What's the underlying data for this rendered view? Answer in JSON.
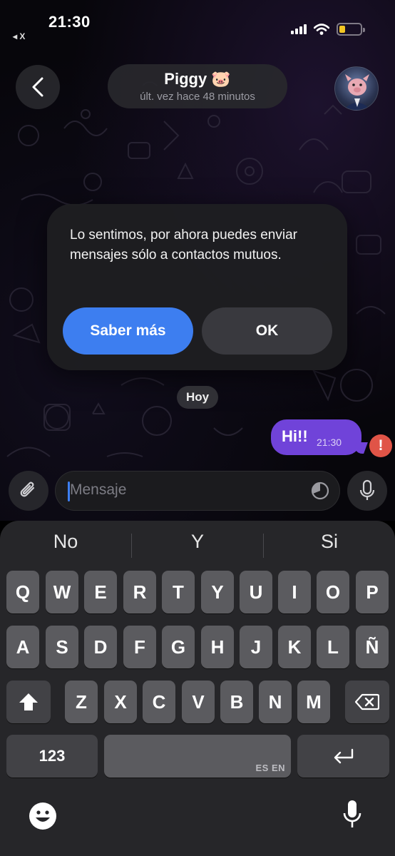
{
  "status_bar": {
    "time": "21:30",
    "back_app": "◂ X",
    "battery_color": "#f3c623"
  },
  "header": {
    "back_icon": "chevron-left-icon",
    "contact_name": "Piggy 🐷",
    "last_seen": "últ. vez hace 48 minutos",
    "avatar_icon": "avatar-pig-suit"
  },
  "alert": {
    "message": "Lo sentimos, por ahora puedes enviar mensajes sólo a contactos mutuos.",
    "learn_more_label": "Saber más",
    "ok_label": "OK",
    "accent": "#3d7ef0"
  },
  "chat": {
    "date_label": "Hoy",
    "messages": [
      {
        "text": "Hi!!",
        "time": "21:30",
        "outgoing": true,
        "failed": true,
        "error_badge": "!"
      }
    ],
    "bubble_color": "#7043d9"
  },
  "composer": {
    "attach_icon": "paperclip-icon",
    "placeholder": "Mensaje",
    "timer_icon": "timer-icon",
    "mic_icon": "microphone-icon"
  },
  "keyboard": {
    "suggestions": [
      "No",
      "Y",
      "Si"
    ],
    "rows": [
      [
        "Q",
        "W",
        "E",
        "R",
        "T",
        "Y",
        "U",
        "I",
        "O",
        "P"
      ],
      [
        "A",
        "S",
        "D",
        "F",
        "G",
        "H",
        "J",
        "K",
        "L",
        "Ñ"
      ],
      [
        "Z",
        "X",
        "C",
        "V",
        "B",
        "N",
        "M"
      ]
    ],
    "numbers_label": "123",
    "space_lang": "ES EN",
    "shift_icon": "shift-icon",
    "delete_icon": "delete-icon",
    "return_icon": "return-icon",
    "emoji_icon": "emoji-icon",
    "dictation_icon": "microphone-icon"
  }
}
